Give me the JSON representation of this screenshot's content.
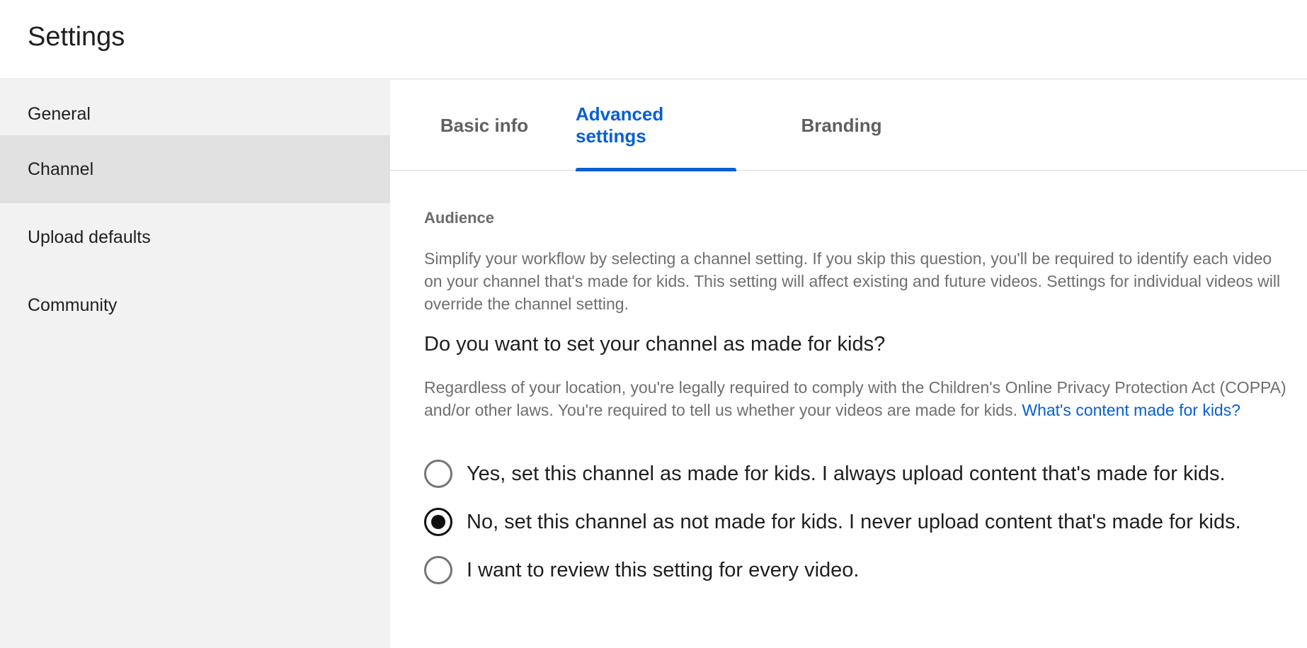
{
  "header": {
    "title": "Settings"
  },
  "sidebar": {
    "items": [
      {
        "label": "General"
      },
      {
        "label": "Channel"
      },
      {
        "label": "Upload defaults"
      },
      {
        "label": "Community"
      }
    ],
    "active": "Channel"
  },
  "tabs": {
    "items": [
      {
        "label": "Basic info"
      },
      {
        "label": "Advanced settings"
      },
      {
        "label": "Branding"
      }
    ],
    "active": "Advanced settings"
  },
  "audience": {
    "section_label": "Audience",
    "description": "Simplify your workflow by selecting a channel setting. If you skip this question, you'll be required to identify each video on your channel that's made for kids. This setting will affect existing and future videos. Settings for individual videos will override the channel setting.",
    "question": "Do you want to set your channel as made for kids?",
    "coppa_text": "Regardless of your location, you're legally required to comply with the Children's Online Privacy Protection Act (COPPA) and/or other laws. You're required to tell us whether your videos are made for kids.",
    "coppa_link": "What's content made for kids?",
    "options": [
      {
        "label": "Yes, set this channel as made for kids. I always upload content that's made for kids.",
        "checked": false
      },
      {
        "label": "No, set this channel as not made for kids. I never upload content that's made for kids.",
        "checked": true
      },
      {
        "label": "I want to review this setting for every video.",
        "checked": false
      }
    ]
  },
  "colors": {
    "accent": "#065fd4",
    "sidebar_bg": "#f2f2f2",
    "sidebar_active_bg": "#e1e1e1"
  }
}
